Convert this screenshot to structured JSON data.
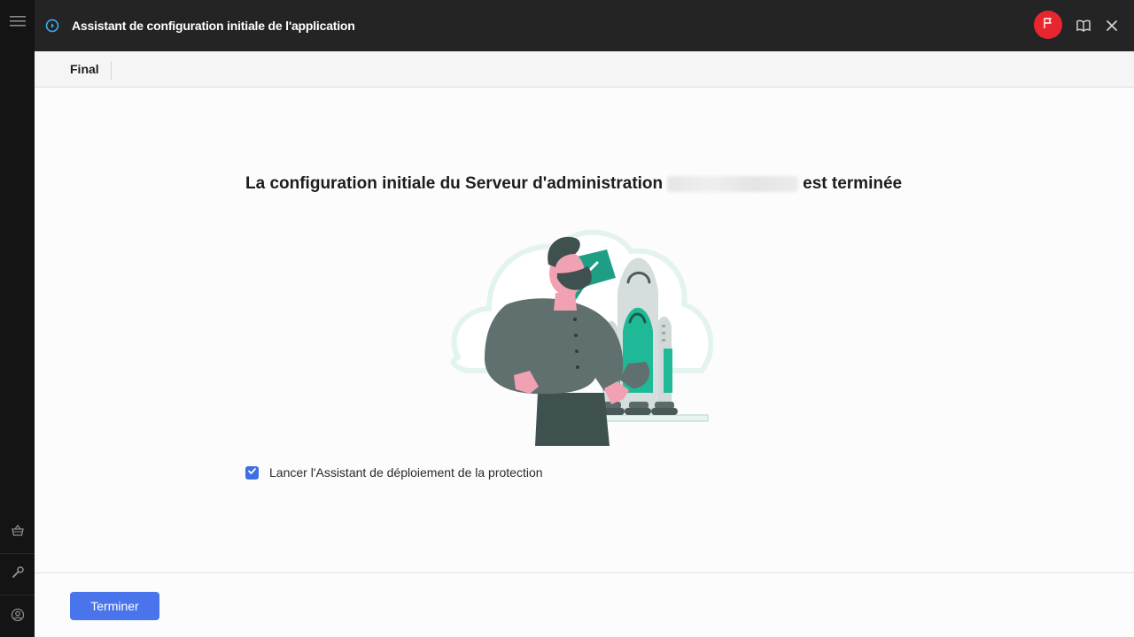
{
  "window": {
    "title": "Assistant de configuration initiale de l'application"
  },
  "tabs": {
    "active_label": "Final"
  },
  "main": {
    "headline_before": "La configuration initiale du Serveur d'administration",
    "headline_after": "est terminée",
    "checkbox": {
      "label": "Lancer l'Assistant de déploiement de la protection",
      "checked": true
    }
  },
  "footer": {
    "finish_label": "Terminer"
  },
  "colors": {
    "accent": "#4a74ec",
    "titlebar": "#242424",
    "flag": "#e8262f",
    "teal": "#1fb998"
  },
  "icons": {
    "rail": [
      "menu-icon",
      "basket-icon",
      "wrench-icon",
      "user-circle-icon"
    ],
    "titlebar": [
      "play-circle-icon",
      "flag-icon",
      "book-icon",
      "close-icon"
    ]
  }
}
